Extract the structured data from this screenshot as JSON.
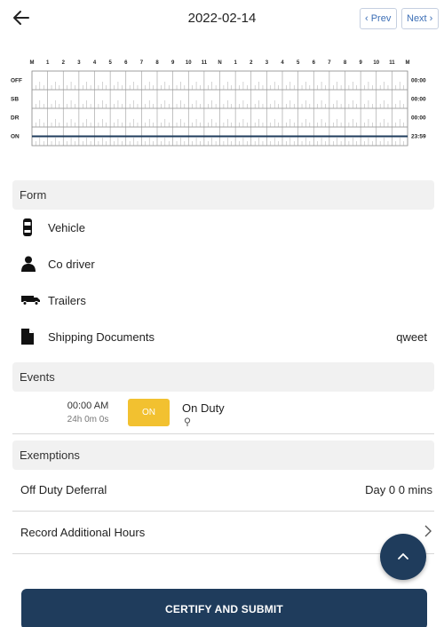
{
  "header": {
    "date": "2022-02-14",
    "prev_label": "‹ Prev",
    "next_label": "Next ›"
  },
  "log_grid": {
    "hour_labels": [
      "M",
      "1",
      "2",
      "3",
      "4",
      "5",
      "6",
      "7",
      "8",
      "9",
      "10",
      "11",
      "N",
      "1",
      "2",
      "3",
      "4",
      "5",
      "6",
      "7",
      "8",
      "9",
      "10",
      "11",
      "M"
    ],
    "status_rows": [
      {
        "label": "OFF",
        "total": "00:00"
      },
      {
        "label": "SB",
        "total": "00:00"
      },
      {
        "label": "DR",
        "total": "00:00"
      },
      {
        "label": "ON",
        "total": "23:59"
      }
    ],
    "line_color": "#1f3c5c"
  },
  "form": {
    "title": "Form",
    "items": [
      {
        "label": "Vehicle",
        "icon": "vehicle-icon",
        "value": ""
      },
      {
        "label": "Co driver",
        "icon": "person-icon",
        "value": ""
      },
      {
        "label": "Trailers",
        "icon": "truck-icon",
        "value": ""
      },
      {
        "label": "Shipping Documents",
        "icon": "document-icon",
        "value": "qweet"
      }
    ]
  },
  "events": {
    "title": "Events",
    "items": [
      {
        "time": "00:00 AM",
        "duration": "24h 0m 0s",
        "badge": "ON",
        "status": "On Duty",
        "badge_color": "#f2c130"
      }
    ]
  },
  "exemptions": {
    "title": "Exemptions",
    "off_duty_deferral": {
      "label": "Off Duty Deferral",
      "value": "Day 0 0 mins"
    },
    "record_additional_hours": {
      "label": "Record Additional Hours"
    }
  },
  "actions": {
    "certify_label": "CERTIFY AND SUBMIT",
    "accent": "#1f3c5c"
  }
}
